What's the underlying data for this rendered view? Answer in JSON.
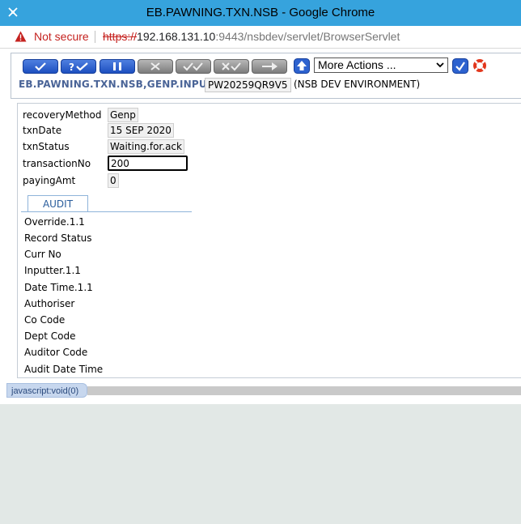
{
  "window": {
    "title": "EB.PAWNING.TXN.NSB - Google Chrome"
  },
  "addressbar": {
    "security_label": "Not secure",
    "url_scheme": "https://",
    "url_host": "192.168.131.10",
    "url_path": ":9443/nsbdev/servlet/BrowserServlet"
  },
  "toolbar": {
    "buttons": [
      {
        "name": "commit-deal",
        "icon": "check-icon",
        "color": "#2353c6"
      },
      {
        "name": "validate-deal",
        "icon": "question-check-icon",
        "color": "#2353c6"
      },
      {
        "name": "hold-deal",
        "icon": "pause-icon",
        "color": "#2353c6"
      },
      {
        "name": "delete-deal",
        "icon": "x-icon",
        "color": "#8a8a8a"
      },
      {
        "name": "authorise-deal",
        "icon": "double-check-icon",
        "color": "#8a8a8a"
      },
      {
        "name": "reverse-deal",
        "icon": "x-check-icon",
        "color": "#8a8a8a"
      },
      {
        "name": "next-deal",
        "icon": "arrow-right-icon",
        "color": "#8a8a8a"
      }
    ],
    "more_actions": "More Actions ...",
    "version_name": "EB.PAWNING.TXN.NSB,GENP.INPUT",
    "transaction_id": "PW20259QR9V5",
    "environment": "(NSB DEV ENVIRONMENT)"
  },
  "form": {
    "fields": [
      {
        "label": "recoveryMethod",
        "value": "Genp"
      },
      {
        "label": "txnDate",
        "value": "15 SEP 2020"
      },
      {
        "label": "txnStatus",
        "value": "Waiting.for.ack"
      },
      {
        "label": "transactionNo",
        "value": "200"
      },
      {
        "label": "payingAmt",
        "value": "0"
      }
    ]
  },
  "audit": {
    "tab_label": "AUDIT",
    "labels": [
      "Override.1.1",
      "Record Status",
      "Curr No",
      "Inputter.1.1",
      "Date Time.1.1",
      "Authoriser",
      "Co Code",
      "Dept Code",
      "Auditor Code",
      "Audit Date Time"
    ]
  },
  "status": {
    "text": "javascript:void(0)"
  }
}
